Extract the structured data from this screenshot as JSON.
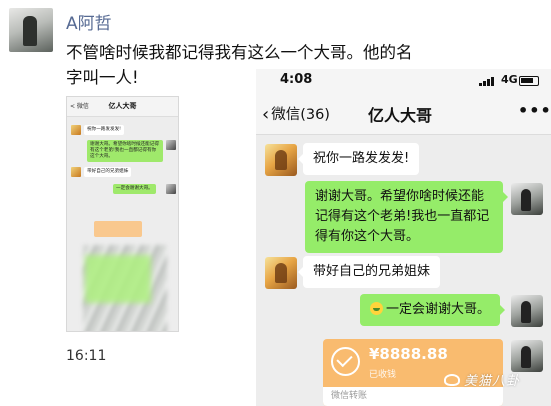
{
  "post": {
    "author": "A阿哲",
    "text": "不管啥时候我都记得我有这么一个大哥。他的名字叫一人!",
    "time": "16:11"
  },
  "thumbnail": {
    "title": "亿人大哥",
    "back": "< 微信",
    "messages": [
      {
        "side": "left",
        "text": "祝你一路发发发!"
      },
      {
        "side": "right",
        "text": "谢谢大哥。希望你啥时候还能记得有这个老弟!我也一直都记得有你这个大哥。"
      },
      {
        "side": "left",
        "text": "带好自己的兄弟姐妹"
      },
      {
        "side": "right",
        "text": "一定会谢谢大哥。"
      }
    ]
  },
  "phone": {
    "status_time": "4:08",
    "network": "4G",
    "back_label": "微信(36)",
    "chat_title": "亿人大哥",
    "more_label": "•••",
    "messages": [
      {
        "side": "left",
        "text": "祝你一路发发发!"
      },
      {
        "side": "right",
        "text": "谢谢大哥。希望你啥时候还能记得有这个老弟!我也一直都记得有你这个大哥。"
      },
      {
        "side": "left",
        "text": "带好自己的兄弟姐妹"
      },
      {
        "side": "right",
        "text": "一定会谢谢大哥。"
      }
    ],
    "transfer": {
      "amount": "¥8888.88",
      "status": "已收钱",
      "footer": "微信转账"
    }
  },
  "watermark": "美猫八卦",
  "colors": {
    "name_link": "#566a93",
    "bubble_green": "#95ec69",
    "transfer_orange": "#f9bb6f",
    "chat_bg": "#ededed"
  }
}
